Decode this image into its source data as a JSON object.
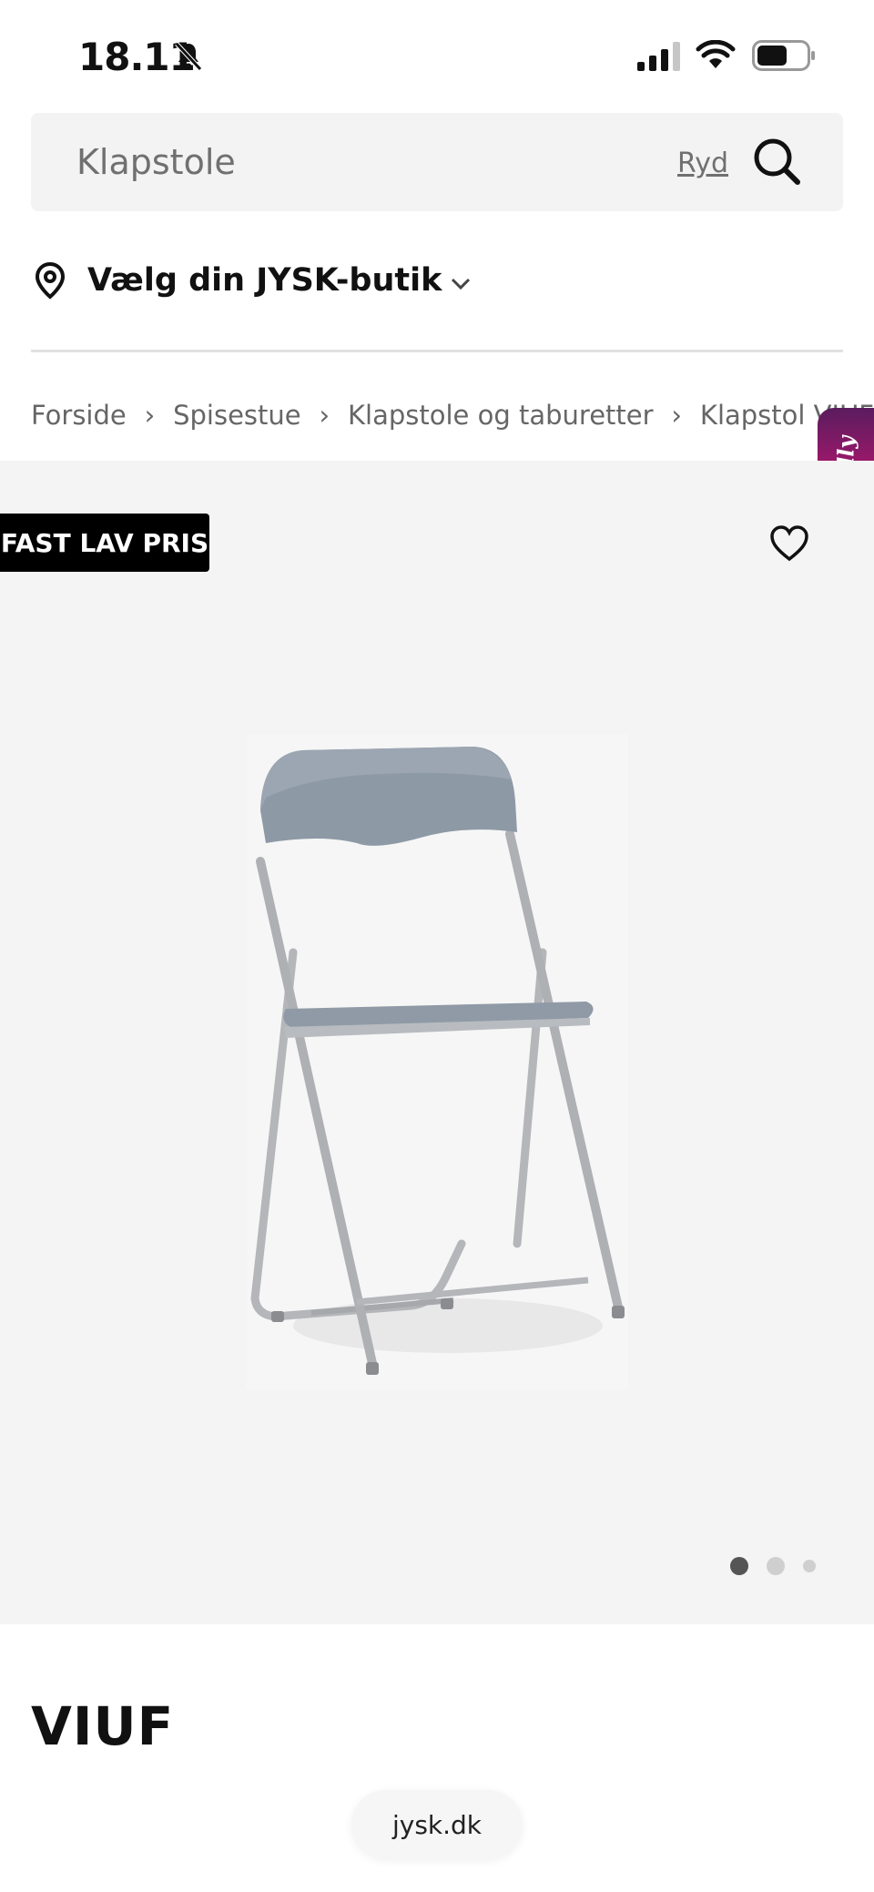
{
  "status_bar": {
    "time": "18.11",
    "icons": [
      "bell-slash-icon",
      "signal-icon",
      "wifi-icon",
      "battery-icon"
    ]
  },
  "search": {
    "value": "Klapstole",
    "clear_label": "Ryd",
    "icon": "search-icon"
  },
  "store_selector": {
    "label": "Vælg din JYSK-butik",
    "icon": "location-pin-icon"
  },
  "breadcrumb": [
    "Forside",
    "Spisestue",
    "Klapstole og taburetter",
    "Klapstol VIUF"
  ],
  "chat_widget": {
    "label": "Molly"
  },
  "gallery": {
    "badge": "FAST LAV PRIS",
    "image_count": 3,
    "active_index": 0,
    "image_alt": "Klapstol VIUF grå"
  },
  "product": {
    "title": "VIUF"
  },
  "browser": {
    "url": "jysk.dk"
  },
  "colors": {
    "badge_bg": "#000000",
    "gallery_bg": "#f4f4f4",
    "molly_gradient_start": "#5a1c5e",
    "molly_gradient_end": "#d2145f"
  }
}
